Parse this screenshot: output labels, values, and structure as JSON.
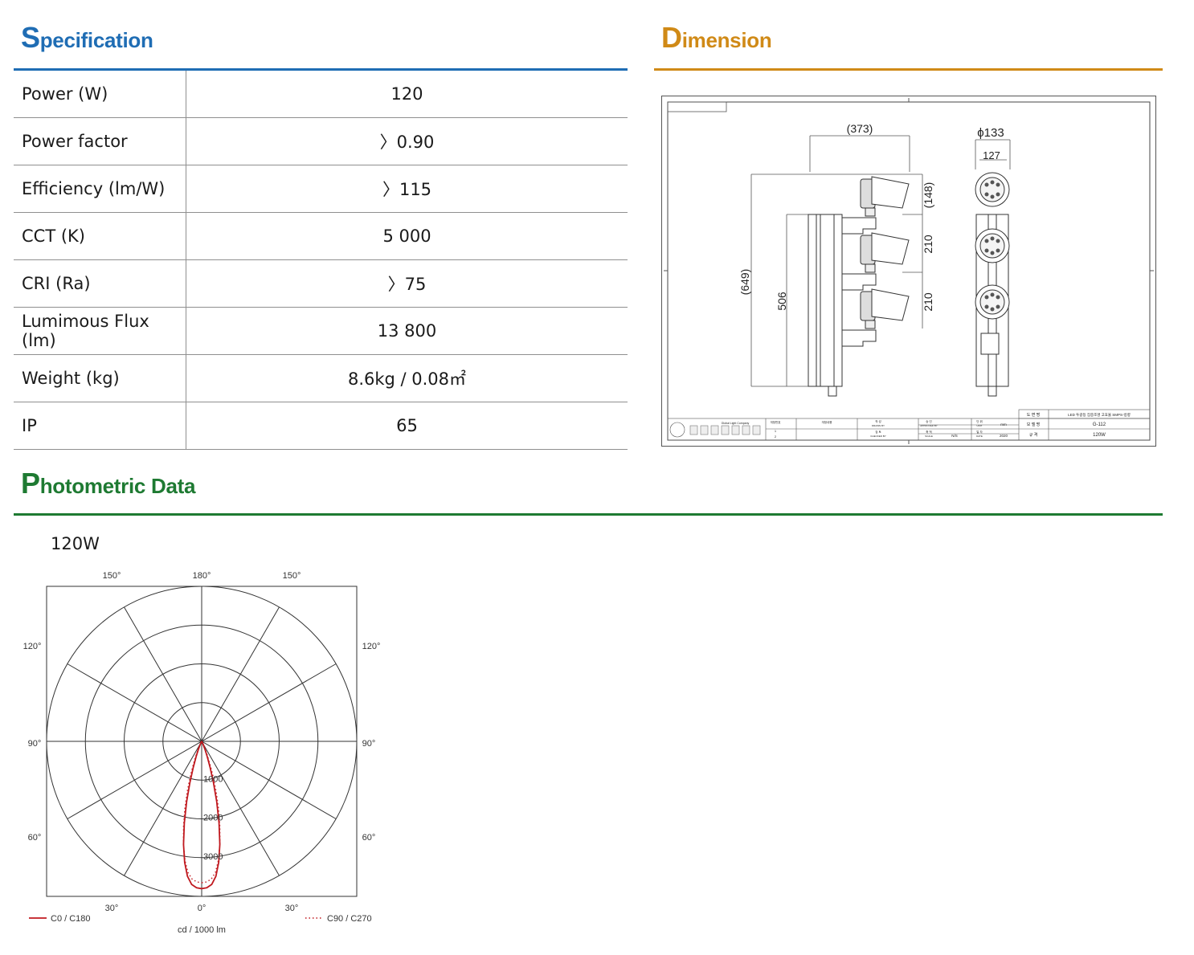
{
  "specification": {
    "title_cap": "S",
    "title_rest": "pecification",
    "rows": [
      {
        "key": "Power (W)",
        "value": "120"
      },
      {
        "key": "Power factor",
        "value": "〉0.90"
      },
      {
        "key": "Efficiency (lm/W)",
        "value": "〉115"
      },
      {
        "key": "CCT (K)",
        "value": "5 000"
      },
      {
        "key": "CRI (Ra)",
        "value": "〉75"
      },
      {
        "key": "Lumimous Flux (lm)",
        "value": "13 800"
      },
      {
        "key": "Weight (kg)",
        "value": "8.6kg / 0.08㎡"
      },
      {
        "key": "IP",
        "value": "65"
      }
    ]
  },
  "dimension": {
    "title_cap": "D",
    "title_rest": "imension",
    "labels": {
      "width_total": "(373)",
      "diameter": "ϕ133",
      "width_side": "127",
      "height_total": "(649)",
      "height_body": "506",
      "head_height": "(148)",
      "spacing_1": "210",
      "spacing_2": "210"
    },
    "title_block": {
      "company": "Global Light Company",
      "drawing_name_label": "도 면 명",
      "drawing_name": "LED 투광등 집중조명 고효율 SMPS-방향",
      "model_label": "모 델 명",
      "model": "G-112",
      "spec_label": "규 격",
      "spec": "120W",
      "unit": "mm",
      "scale": "N/S",
      "year": "2020",
      "rev_label": "개정번호",
      "rev_content_label": "개정내용",
      "rev_1": "1",
      "rev_2": "2",
      "drawn_label": "작 성",
      "drawn_en": "DRAWN BY",
      "checked_label": "검 토",
      "checked_en": "CHECKED BY",
      "approved_label": "승 인",
      "approved_en": "APPROVED BY",
      "scale_label": "축 척",
      "scale_en": "SCALE",
      "unit_label": "단 위",
      "unit_en": "UNIT",
      "date_label": "일 자",
      "date_en": "DATE"
    }
  },
  "photometric": {
    "title_cap": "P",
    "title_rest": "hotometric Data",
    "chart_label": "120W"
  },
  "colors": {
    "spec_accent": "#1f6db4",
    "dimension_accent": "#d08a17",
    "photometric_accent": "#1e7a32",
    "curve": "#c0191f"
  },
  "chart_data": {
    "type": "polar",
    "title": "120W",
    "unit_label": "cd / 1000 lm",
    "angle_labels_top": [
      "150°",
      "180°",
      "150°"
    ],
    "angle_labels_side": [
      "120°",
      "90°",
      "60°"
    ],
    "angle_labels_bottom": [
      "30°",
      "0°",
      "30°"
    ],
    "radial_ticks": [
      1000,
      2000,
      3000
    ],
    "rlim": [
      0,
      4000
    ],
    "series": [
      {
        "name": "C0 / C180",
        "style": "solid",
        "angles": [
          0,
          2,
          4,
          6,
          8,
          10,
          12,
          14,
          16,
          18,
          20,
          22,
          24,
          26,
          28,
          30
        ],
        "values": [
          3800,
          3780,
          3700,
          3500,
          3150,
          2700,
          2150,
          1600,
          1100,
          700,
          420,
          250,
          140,
          80,
          40,
          10
        ]
      },
      {
        "name": "C90 / C270",
        "style": "dotted",
        "angles": [
          0,
          2,
          4,
          6,
          8,
          10,
          12,
          14,
          16,
          18,
          20,
          22,
          24,
          26,
          28,
          30
        ],
        "values": [
          3650,
          3630,
          3560,
          3400,
          3100,
          2700,
          2250,
          1800,
          1350,
          950,
          620,
          380,
          210,
          110,
          50,
          10
        ]
      }
    ],
    "grid": true,
    "legend": "bottom"
  }
}
